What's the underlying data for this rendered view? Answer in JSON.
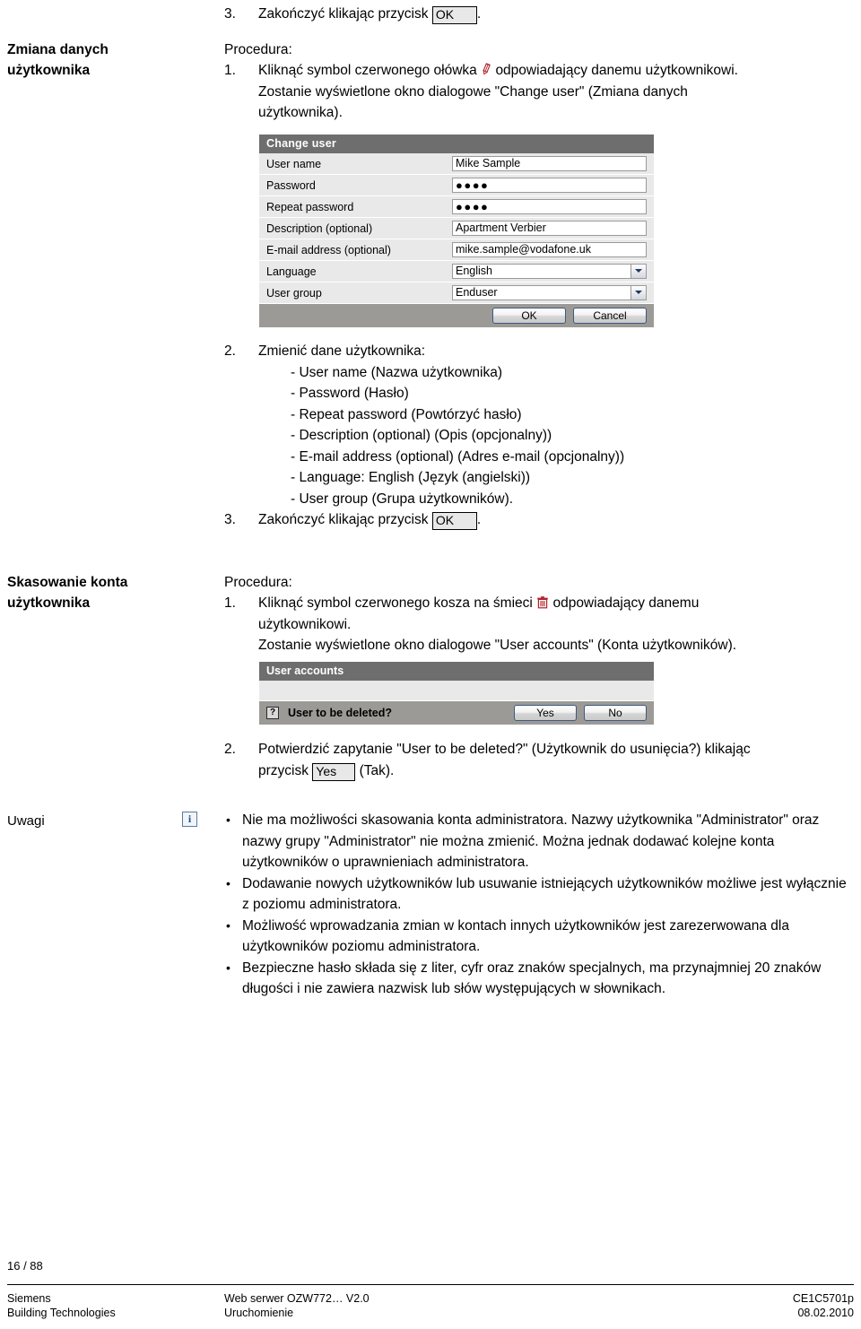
{
  "top_step": {
    "number": "3.",
    "text_before": "Zakończyć klikając przycisk",
    "button_label": "OK",
    "text_after": "."
  },
  "section_change_user": {
    "margin_heading_line1": "Zmiana danych",
    "margin_heading_line2": "użytkownika",
    "procedure_label": "Procedura:",
    "step1": {
      "number": "1.",
      "line1_before": "Kliknąć symbol czerwonego ołówka",
      "icon": "red-pencil-icon",
      "line1_after": "odpowiadający danemu użytkownikowi.",
      "line2": "Zostanie wyświetlone okno dialogowe \"Change user\" (Zmiana danych",
      "line3": "użytkownika)."
    },
    "step2": {
      "number": "2.",
      "intro": "Zmienić dane użytkownika:",
      "items": [
        "- User name (Nazwa użytkownika)",
        "- Password (Hasło)",
        "- Repeat password (Powtórzyć hasło)",
        "- Description (optional) (Opis (opcjonalny))",
        "- E-mail address (optional) (Adres e-mail (opcjonalny))",
        "- Language: English (Język (angielski))",
        "- User group (Grupa użytkowników)."
      ]
    },
    "step3": {
      "number": "3.",
      "text_before": "Zakończyć klikając przycisk",
      "button_label": "OK",
      "text_after": "."
    }
  },
  "change_user_dialog": {
    "title": "Change user",
    "rows": [
      {
        "label": "User name",
        "value": "Mike Sample",
        "type": "text"
      },
      {
        "label": "Password",
        "value": "●●●●",
        "type": "password"
      },
      {
        "label": "Repeat password",
        "value": "●●●●",
        "type": "password"
      },
      {
        "label": "Description (optional)",
        "value": "Apartment Verbier",
        "type": "text"
      },
      {
        "label": "E-mail address (optional)",
        "value": "mike.sample@vodafone.uk",
        "type": "text"
      },
      {
        "label": "Language",
        "value": "English",
        "type": "select"
      },
      {
        "label": "User group",
        "value": "Enduser",
        "type": "select"
      }
    ],
    "ok_label": "OK",
    "cancel_label": "Cancel"
  },
  "section_delete_user": {
    "margin_heading_line1": "Skasowanie konta",
    "margin_heading_line2": "użytkownika",
    "procedure_label": "Procedura:",
    "step1": {
      "number": "1.",
      "line1_before": "Kliknąć symbol czerwonego kosza na śmieci",
      "icon": "red-trash-icon",
      "line1_after": "odpowiadający danemu",
      "line2": "użytkownikowi.",
      "line3": "Zostanie wyświetlone okno dialogowe \"User accounts\" (Konta użytkowników)."
    },
    "step2": {
      "number": "2.",
      "line1": "Potwierdzić zapytanie \"User to be deleted?\" (Użytkownik do usunięcia?) klikając",
      "line2_before": "przycisk",
      "button_label": "Yes",
      "line2_after": "(Tak)."
    }
  },
  "user_accounts_dialog": {
    "title": "User accounts",
    "question_icon": "?",
    "question": "User to be deleted?",
    "yes_label": "Yes",
    "no_label": "No"
  },
  "notes": {
    "margin_heading": "Uwagi",
    "icon": "info-icon",
    "bullets": [
      "Nie ma możliwości skasowania konta administratora. Nazwy użytkownika \"Administrator\" oraz nazwy grupy \"Administrator\" nie można zmienić. Można jednak dodawać kolejne konta użytkowników o uprawnieniach administratora.",
      "Dodawanie nowych użytkowników lub usuwanie istniejących użytkowników możliwe jest wyłącznie z poziomu administratora.",
      "Możliwość wprowadzania zmian w kontach innych użytkowników jest zarezerwowana dla użytkowników poziomu administratora.",
      "Bezpieczne hasło składa się z liter, cyfr oraz znaków specjalnych, ma przynajmniej 20 znaków długości i nie zawiera nazwisk lub słów występujących w słownikach."
    ]
  },
  "footer": {
    "page_number": "16 / 88",
    "col1_line1": "Siemens",
    "col1_line2": "Building Technologies",
    "col2_line1": "Web serwer OZW772… V2.0",
    "col2_line2": "Uruchomienie",
    "col3_line1": "CE1C5701p",
    "col3_line2": "08.02.2010"
  },
  "colors": {
    "dialog_title_bg": "#6e6e6e",
    "dialog_row_bg": "#e9e9e9",
    "dialog_footer_bg": "#9c9a97",
    "icon_red": "#c0282d",
    "icon_blue": "#1d4f8f"
  }
}
